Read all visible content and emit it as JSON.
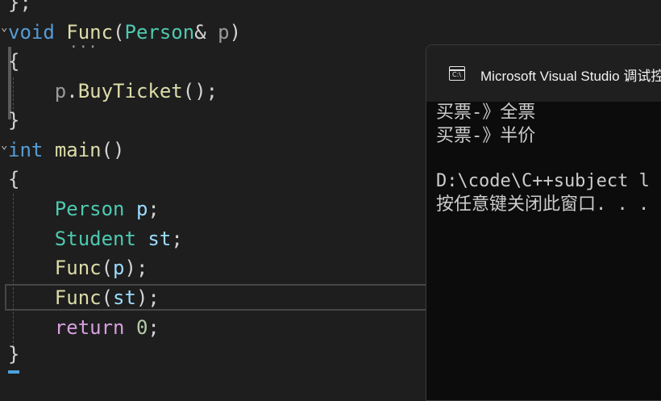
{
  "editor": {
    "lines": {
      "l0": {
        "punc": "};"
      },
      "l1": {
        "kw": "void",
        "fn": "Func",
        "open": "(",
        "type": "Person",
        "amp": "&",
        "param": "p",
        "close": ")"
      },
      "l2": {
        "punc": "{"
      },
      "l3": {
        "param": "p",
        "dot": ".",
        "fn": "BuyTicket",
        "rest": "();"
      },
      "l4": {
        "punc": "}"
      },
      "l5": {
        "kw": "int",
        "fn": "main",
        "rest": "()"
      },
      "l6": {
        "punc": "{"
      },
      "l7": {
        "type": "Person",
        "var": "p",
        "semi": ";"
      },
      "l8": {
        "type": "Student",
        "var": "st",
        "semi": ";"
      },
      "l9": {
        "fn": "Func",
        "open": "(",
        "var": "p",
        "close": ");"
      },
      "l10": {
        "fn": "Func",
        "open": "(",
        "var": "st",
        "close": ");"
      },
      "l11": {
        "kw": "return",
        "num": "0",
        "semi": ";"
      },
      "l12": {
        "punc": "}"
      }
    },
    "fold_glyph": "⌄",
    "dots": "···",
    "colors": {
      "keyword": "#569cd6",
      "control": "#d8a0df",
      "type": "#4ec9b0",
      "function": "#dcdcaa",
      "variable": "#9cdcfe",
      "number": "#b5cea8"
    }
  },
  "console": {
    "title": "Microsoft Visual Studio 调试控制台",
    "icon": "console-window-icon",
    "icon_text": "C:\\",
    "output": {
      "line1": "买票-》全票",
      "line2": "买票-》半价",
      "line3": "D:\\code\\C++subject l",
      "line4": "按任意键关闭此窗口. . ."
    }
  }
}
